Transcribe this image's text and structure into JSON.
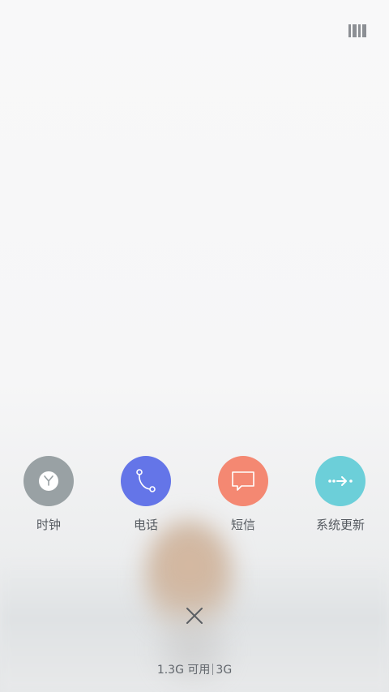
{
  "apps": [
    {
      "label": "时钟",
      "icon": "clock-icon",
      "color": "#99a1a4"
    },
    {
      "label": "电话",
      "icon": "phone-icon",
      "color": "#6475e8"
    },
    {
      "label": "短信",
      "icon": "message-icon",
      "color": "#f48872"
    },
    {
      "label": "系统更新",
      "icon": "update-arrow-icon",
      "color": "#6ccfd9"
    }
  ],
  "close_icon": "close-icon",
  "memory": {
    "available": "1.3G 可用",
    "total": "3G"
  },
  "memory_icon": "memory-icon"
}
